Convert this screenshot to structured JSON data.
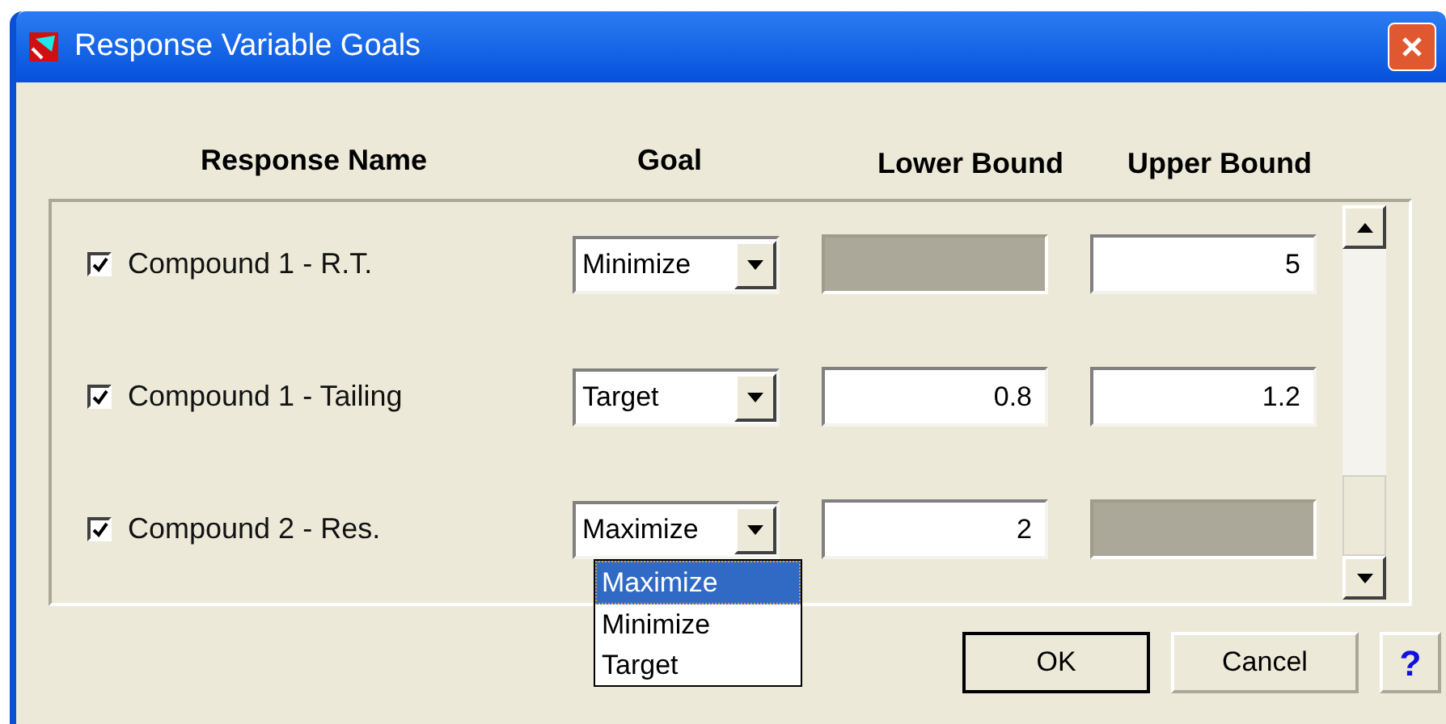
{
  "window": {
    "title": "Response Variable Goals"
  },
  "headers": [
    "Response Name",
    "Goal",
    "Lower Bound",
    "Upper Bound"
  ],
  "rows": [
    {
      "name": "Compound 1 - R.T.",
      "checked": true,
      "goal": "Minimize",
      "open": false,
      "lower": {
        "disabled": true
      },
      "upper": {
        "disabled": false,
        "value": "5"
      }
    },
    {
      "name": "Compound 1 - Tailing",
      "checked": true,
      "goal": "Target",
      "open": false,
      "lower": {
        "disabled": false,
        "value": "0.8"
      },
      "upper": {
        "disabled": false,
        "value": "1.2"
      }
    },
    {
      "name": "Compound 2 - Res.",
      "checked": true,
      "goal": "Maximize",
      "open": true,
      "lower": {
        "disabled": false,
        "value": "2"
      },
      "upper": {
        "disabled": true
      }
    }
  ],
  "dropdown_options": [
    {
      "label": "Maximize",
      "selected": true
    },
    {
      "label": "Minimize",
      "selected": false
    },
    {
      "label": "Target",
      "selected": false
    }
  ],
  "buttons": [
    {
      "label": "OK",
      "default": true
    },
    {
      "label": "Cancel",
      "default": false
    },
    {
      "label": "?",
      "default": false
    }
  ]
}
